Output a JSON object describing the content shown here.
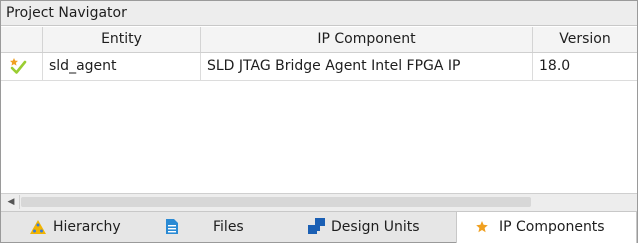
{
  "panel": {
    "title": "Project Navigator"
  },
  "table": {
    "columns": [
      "",
      "Entity",
      "IP Component",
      "Version"
    ],
    "rows": [
      {
        "status_icon": "check-with-star-icon",
        "entity": "sld_agent",
        "ip_component": "SLD JTAG Bridge Agent Intel FPGA IP",
        "version": "18.0"
      }
    ]
  },
  "tabs": [
    {
      "label": "Hierarchy",
      "icon": "hierarchy-triangle-icon",
      "active": false
    },
    {
      "label": "Files",
      "icon": "file-document-icon",
      "active": false
    },
    {
      "label": "Design Units",
      "icon": "design-units-icon",
      "active": false
    },
    {
      "label": "IP Components",
      "icon": "ip-component-icon",
      "active": true
    }
  ],
  "colors": {
    "accent_orange": "#f0a020",
    "check_green": "#9acd32",
    "files_blue": "#2a8ad4",
    "units_blue": "#1a5fb4"
  }
}
